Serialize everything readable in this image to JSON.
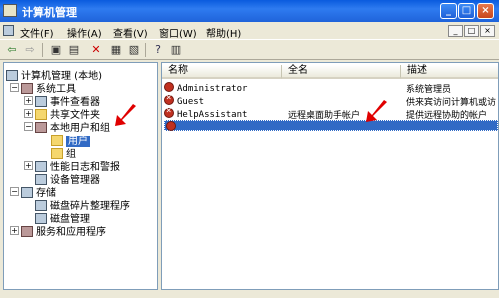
{
  "window": {
    "title": "计算机管理"
  },
  "menu": [
    "文件(F)",
    "操作(A)",
    "查看(V)",
    "窗口(W)",
    "帮助(H)"
  ],
  "inner_buttons": [
    "_",
    "□",
    "×"
  ],
  "window_buttons": [
    "_",
    "□",
    "×"
  ],
  "tree": {
    "root": "计算机管理 (本地)",
    "system_tools": "系统工具",
    "event_viewer": "事件查看器",
    "shared_folders": "共享文件夹",
    "local_users": "本地用户和组",
    "users": "用户",
    "groups": "组",
    "perf_logs": "性能日志和警报",
    "device_manager": "设备管理器",
    "storage": "存储",
    "defrag": "磁盘碎片整理程序",
    "disk_mgmt": "磁盘管理",
    "services": "服务和应用程序"
  },
  "list": {
    "columns": [
      "名称",
      "全名",
      "描述"
    ],
    "rows": [
      {
        "name": "Administrator",
        "fullname": "",
        "desc": "系统管理员"
      },
      {
        "name": "Guest",
        "fullname": "",
        "desc": "供来宾访问计算机或访"
      },
      {
        "name": "HelpAssistant",
        "fullname": "远程桌面助手帐户",
        "desc": "提供远程协助的帐户"
      }
    ]
  },
  "colors": {
    "selection": "#316AC5",
    "arrow": "#E00000",
    "titlebar": "#0A5BDE"
  }
}
